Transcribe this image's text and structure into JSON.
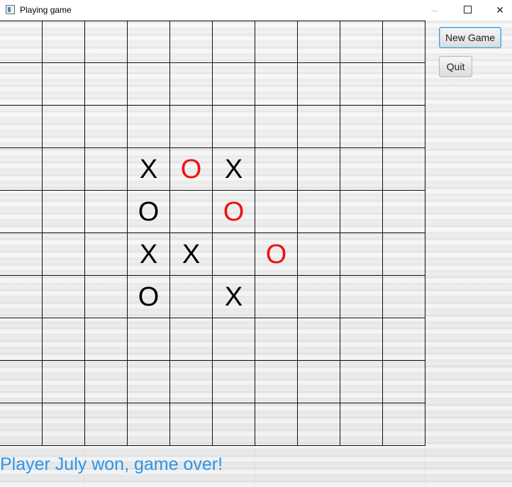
{
  "window": {
    "title": "Playing game",
    "controls": [
      "minimize-icon",
      "maximize-icon",
      "close-icon"
    ]
  },
  "buttons": {
    "new_game": "New Game",
    "quit": "Quit"
  },
  "board": {
    "rows": 10,
    "cols": 10,
    "marks": [
      {
        "row": 3,
        "col": 3,
        "mark": "X",
        "color": "#000000"
      },
      {
        "row": 3,
        "col": 4,
        "mark": "O",
        "color": "#ee1111"
      },
      {
        "row": 3,
        "col": 5,
        "mark": "X",
        "color": "#000000"
      },
      {
        "row": 4,
        "col": 3,
        "mark": "O",
        "color": "#000000"
      },
      {
        "row": 4,
        "col": 5,
        "mark": "O",
        "color": "#ee1111"
      },
      {
        "row": 5,
        "col": 3,
        "mark": "X",
        "color": "#000000"
      },
      {
        "row": 5,
        "col": 4,
        "mark": "X",
        "color": "#000000"
      },
      {
        "row": 5,
        "col": 6,
        "mark": "O",
        "color": "#ee1111"
      },
      {
        "row": 6,
        "col": 3,
        "mark": "O",
        "color": "#000000"
      },
      {
        "row": 6,
        "col": 5,
        "mark": "X",
        "color": "#000000"
      }
    ]
  },
  "status": {
    "message": "Player July won, game over!",
    "color": "#2e95e8"
  }
}
